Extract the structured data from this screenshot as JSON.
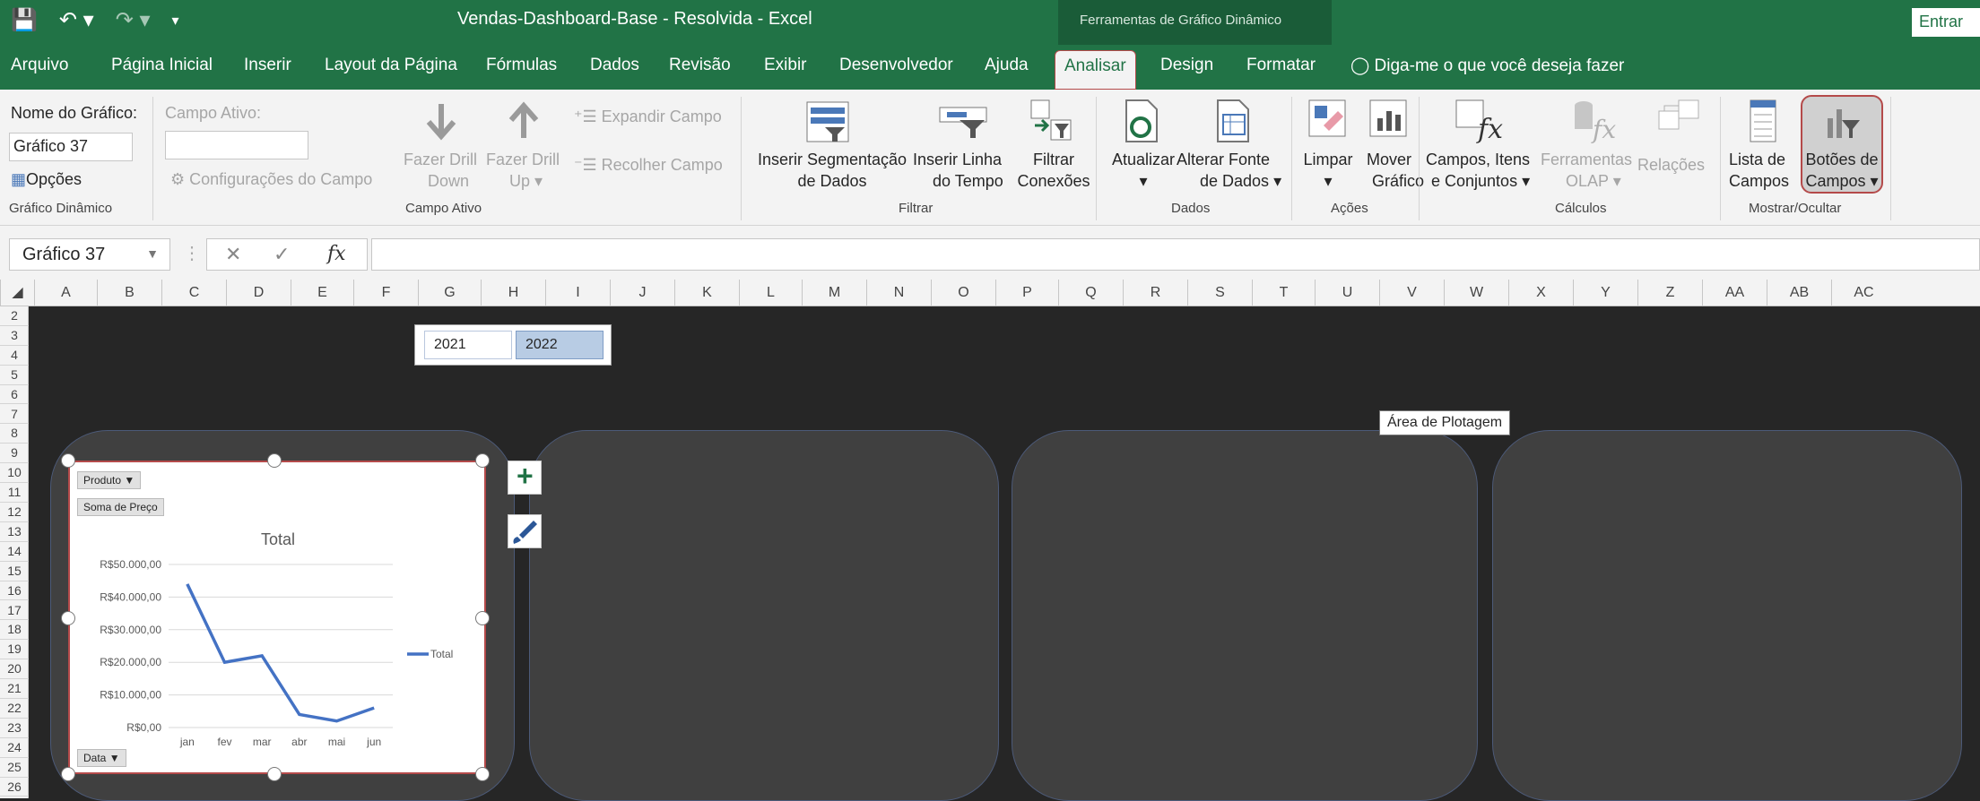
{
  "app": {
    "title": "Vendas-Dashboard-Base - Resolvida  -  Excel",
    "context_tab_group": "Ferramentas de Gráfico Dinâmico",
    "sign_in": "Entrar"
  },
  "tabs": [
    "Arquivo",
    "Página Inicial",
    "Inserir",
    "Layout da Página",
    "Fórmulas",
    "Dados",
    "Revisão",
    "Exibir",
    "Desenvolvedor",
    "Ajuda",
    "Analisar",
    "Design",
    "Formatar"
  ],
  "active_tab": "Analisar",
  "tell_me": "Diga-me o que você deseja fazer",
  "ribbon": {
    "chart_name_label": "Nome do Gráfico:",
    "chart_name_value": "Gráfico 37",
    "options": "Opções",
    "group_pivotchart": "Gráfico Dinâmico",
    "active_field_label": "Campo Ativo:",
    "field_settings": "Configurações do Campo",
    "drill_down_1": "Fazer Drill",
    "drill_down_2": "Down",
    "drill_up_1": "Fazer Drill",
    "drill_up_2": "Up",
    "expand_field": "Expandir Campo",
    "collapse_field": "Recolher Campo",
    "group_active_field": "Campo Ativo",
    "insert_slicer_1": "Inserir Segmentação",
    "insert_slicer_2": "de Dados",
    "insert_timeline_1": "Inserir Linha",
    "insert_timeline_2": "do Tempo",
    "filter_conn_1": "Filtrar",
    "filter_conn_2": "Conexões",
    "group_filter": "Filtrar",
    "refresh": "Atualizar",
    "change_source_1": "Alterar Fonte",
    "change_source_2": "de Dados",
    "group_data": "Dados",
    "clear": "Limpar",
    "move_chart_1": "Mover",
    "move_chart_2": "Gráfico",
    "group_actions": "Ações",
    "fields_items_1": "Campos, Itens",
    "fields_items_2": "e Conjuntos",
    "olap_tools_1": "Ferramentas",
    "olap_tools_2": "OLAP",
    "relationships": "Relações",
    "group_calc": "Cálculos",
    "field_list_1": "Lista de",
    "field_list_2": "Campos",
    "field_buttons_1": "Botões de",
    "field_buttons_2": "Campos",
    "group_show_hide": "Mostrar/Ocultar"
  },
  "formula_bar": {
    "name_box": "Gráfico 37",
    "fx": "fx",
    "formula": ""
  },
  "columns": [
    "A",
    "B",
    "C",
    "D",
    "E",
    "F",
    "G",
    "H",
    "I",
    "J",
    "K",
    "L",
    "M",
    "N",
    "O",
    "P",
    "Q",
    "R",
    "S",
    "T",
    "U",
    "V",
    "W",
    "X",
    "Y",
    "Z",
    "AA",
    "AB",
    "AC"
  ],
  "rows": [
    "2",
    "3",
    "4",
    "5",
    "6",
    "7",
    "8",
    "9",
    "10",
    "11",
    "12",
    "13",
    "14",
    "15",
    "16",
    "17",
    "18",
    "19",
    "20",
    "21",
    "22",
    "23",
    "24",
    "25",
    "26"
  ],
  "slicer": {
    "items": [
      {
        "label": "2021",
        "selected": false
      },
      {
        "label": "2022",
        "selected": true
      }
    ]
  },
  "tooltip": "Área de Plotagem",
  "chart": {
    "field_button_product": "Produto",
    "value_button": "Soma de Preço",
    "axis_button": "Data",
    "side_plus": "+",
    "side_brush": "brush-icon"
  },
  "chart_data": {
    "type": "line",
    "title": "Total",
    "categories": [
      "jan",
      "fev",
      "mar",
      "abr",
      "mai",
      "jun"
    ],
    "series": [
      {
        "name": "Total",
        "values": [
          44000,
          20000,
          22000,
          4000,
          2000,
          6000
        ],
        "color": "#4472c4"
      }
    ],
    "y_ticks": [
      "R$0,00",
      "R$10.000,00",
      "R$20.000,00",
      "R$30.000,00",
      "R$40.000,00",
      "R$50.000,00"
    ],
    "ylim": [
      0,
      50000
    ],
    "grid": true,
    "legend": "right"
  },
  "colors": {
    "excel_green": "#217346",
    "selection_red": "#b44a4a",
    "series_blue": "#4472c4"
  }
}
